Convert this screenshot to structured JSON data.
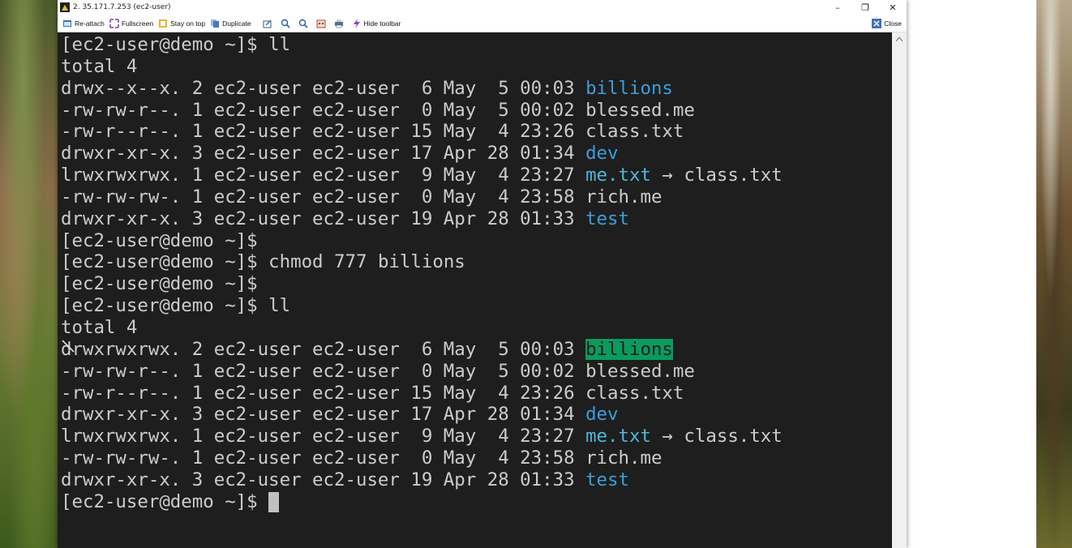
{
  "window": {
    "title": "2. 35.171.7.253 (ec2-user)",
    "minimize": "–",
    "maximize": "❐",
    "close": "✕"
  },
  "toolbar": {
    "reattach": "Re-attach",
    "fullscreen": "Fullscreen",
    "stay_on_top": "Stay on top",
    "duplicate": "Duplicate",
    "hide_toolbar": "Hide toolbar",
    "close": "Close"
  },
  "terminal": {
    "prompt": "[ec2-user@demo ~]$",
    "lines": [
      {
        "type": "cmd",
        "cmd": " ll"
      },
      {
        "type": "text",
        "text": "total 4"
      },
      {
        "type": "entry",
        "meta": "drwx--x--x. 2 ec2-user ec2-user  6 May  5 00:03 ",
        "name": "billions",
        "kind": "dir"
      },
      {
        "type": "entry",
        "meta": "-rw-rw-r--. 1 ec2-user ec2-user  0 May  5 00:02 ",
        "name": "blessed.me",
        "kind": "file"
      },
      {
        "type": "entry",
        "meta": "-rw-r--r--. 1 ec2-user ec2-user 15 May  4 23:26 ",
        "name": "class.txt",
        "kind": "file"
      },
      {
        "type": "entry",
        "meta": "drwxr-xr-x. 3 ec2-user ec2-user 17 Apr 28 01:34 ",
        "name": "dev",
        "kind": "dir"
      },
      {
        "type": "entry",
        "meta": "lrwxrwxrwx. 1 ec2-user ec2-user  9 May  4 23:27 ",
        "name": "me.txt",
        "kind": "link",
        "target": " → class.txt"
      },
      {
        "type": "entry",
        "meta": "-rw-rw-rw-. 1 ec2-user ec2-user  0 May  4 23:58 ",
        "name": "rich.me",
        "kind": "file"
      },
      {
        "type": "entry",
        "meta": "drwxr-xr-x. 3 ec2-user ec2-user 19 Apr 28 01:33 ",
        "name": "test",
        "kind": "dir"
      },
      {
        "type": "cmd",
        "cmd": ""
      },
      {
        "type": "cmd",
        "cmd": " chmod 777 billions"
      },
      {
        "type": "cmd",
        "cmd": ""
      },
      {
        "type": "cmd",
        "cmd": " ll"
      },
      {
        "type": "text",
        "text": "total 4"
      },
      {
        "type": "entry",
        "meta": "drwxrwxrwx. 2 ec2-user ec2-user  6 May  5 00:03 ",
        "name": "billions",
        "kind": "ow"
      },
      {
        "type": "entry",
        "meta": "-rw-rw-r--. 1 ec2-user ec2-user  0 May  5 00:02 ",
        "name": "blessed.me",
        "kind": "file"
      },
      {
        "type": "entry",
        "meta": "-rw-r--r--. 1 ec2-user ec2-user 15 May  4 23:26 ",
        "name": "class.txt",
        "kind": "file"
      },
      {
        "type": "entry",
        "meta": "drwxr-xr-x. 3 ec2-user ec2-user 17 Apr 28 01:34 ",
        "name": "dev",
        "kind": "dir"
      },
      {
        "type": "entry",
        "meta": "lrwxrwxrwx. 1 ec2-user ec2-user  9 May  4 23:27 ",
        "name": "me.txt",
        "kind": "link",
        "target": " → class.txt"
      },
      {
        "type": "entry",
        "meta": "-rw-rw-rw-. 1 ec2-user ec2-user  0 May  4 23:58 ",
        "name": "rich.me",
        "kind": "file"
      },
      {
        "type": "entry",
        "meta": "drwxr-xr-x. 3 ec2-user ec2-user 19 Apr 28 01:33 ",
        "name": "test",
        "kind": "dir"
      },
      {
        "type": "cmd",
        "cmd": " ",
        "cursor": true
      }
    ]
  },
  "colors": {
    "terminal_bg": "#1e1e1e",
    "terminal_fg": "#cccccc",
    "dir": "#3b9ede",
    "link": "#4fb6dc",
    "other_writable_bg": "#0a9b5e"
  },
  "icons": {
    "app": "mobaxterm-icon",
    "reattach": "reattach-icon",
    "fullscreen": "fullscreen-icon",
    "stay_on_top": "pin-icon",
    "duplicate": "duplicate-icon",
    "edit": "edit-icon",
    "zoom_in": "zoom-in-icon",
    "zoom_out": "zoom-out-icon",
    "color": "palette-icon",
    "print": "print-icon",
    "hide_toolbar": "lightning-icon",
    "close": "close-icon",
    "next": "chevron-right-icon"
  }
}
